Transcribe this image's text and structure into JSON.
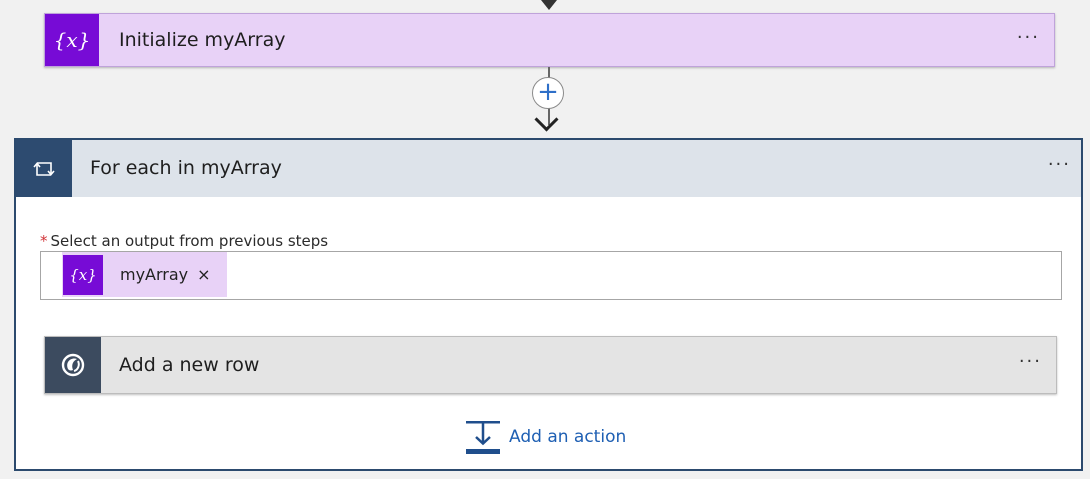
{
  "initialize_card": {
    "title": "Initialize myArray",
    "icon_glyph": "{x}",
    "icon": "variable-icon",
    "more_label": "···",
    "accent_color": "#770bd6",
    "background_color": "#e8d2f7"
  },
  "connector": {
    "add_step_label": "+",
    "icon": "plus-icon"
  },
  "foreach_card": {
    "title": "For each in myArray",
    "icon": "loop-icon",
    "more_label": "···",
    "accent_color": "#2d4b70",
    "field": {
      "required_mark": "*",
      "label": "Select an output from previous steps",
      "token": {
        "icon_glyph": "{x}",
        "icon": "variable-icon",
        "label": "myArray",
        "remove_label": "×"
      }
    },
    "inner_action": {
      "title": "Add a new row",
      "icon": "dataverse-icon",
      "more_label": "···",
      "accent_color": "#3c4b5f"
    },
    "add_action": {
      "label": "Add an action",
      "icon": "add-action-icon",
      "color": "#1e5fb3"
    }
  }
}
